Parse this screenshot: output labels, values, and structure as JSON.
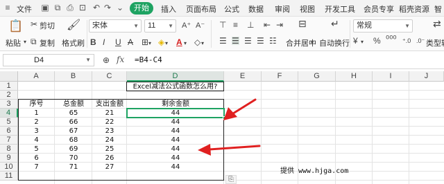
{
  "menubar": {
    "file": "文件",
    "tabs": [
      "开始",
      "插入",
      "页面布局",
      "公式",
      "数据",
      "审阅",
      "视图",
      "开发工具",
      "会员专享",
      "稻壳资源",
      "智"
    ]
  },
  "ribbon": {
    "paste": "粘贴",
    "cut": "剪切",
    "copy": "复制",
    "format_painter": "格式刷",
    "font_name": "宋体",
    "font_size": "11",
    "merge_center": "合并居中",
    "wrap_text": "自动换行",
    "number_format": "常规",
    "convert": "类型转"
  },
  "formula_bar": {
    "cell_ref": "D4",
    "fx": "fx",
    "formula": "=B4-C4"
  },
  "columns": [
    "A",
    "B",
    "C",
    "D",
    "E",
    "F",
    "G",
    "H",
    "I",
    "J"
  ],
  "rows": [
    "1",
    "2",
    "3",
    "4",
    "5",
    "6",
    "7",
    "8",
    "9",
    "10",
    "11"
  ],
  "sheet": {
    "title": "Excel减法公式函数怎么用?",
    "headers": [
      "序号",
      "总金额",
      "支出金额",
      "剩余金额"
    ],
    "data": [
      [
        "1",
        "65",
        "21",
        "44"
      ],
      [
        "2",
        "66",
        "22",
        "44"
      ],
      [
        "3",
        "67",
        "23",
        "44"
      ],
      [
        "4",
        "68",
        "24",
        "44"
      ],
      [
        "5",
        "69",
        "25",
        "44"
      ],
      [
        "6",
        "70",
        "26",
        "44"
      ],
      [
        "7",
        "71",
        "27",
        "44"
      ]
    ],
    "credit": "提供 www.hjga.com"
  },
  "colors": {
    "accent": "#1ea362",
    "arrow": "#e02020"
  }
}
